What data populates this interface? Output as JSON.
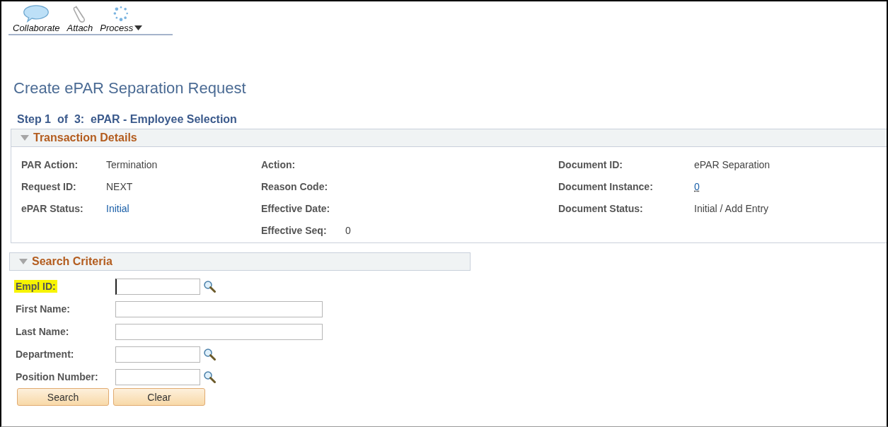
{
  "toolbar": [
    {
      "label": "Collaborate",
      "kind": "bubble",
      "has_menu": false
    },
    {
      "label": "Attach",
      "kind": "clip",
      "has_menu": false
    },
    {
      "label": "Process",
      "kind": "spinner",
      "has_menu": true
    }
  ],
  "title": "Create ePAR Separation Request",
  "step": "Step 1  of  3:  ePAR - Employee Selection",
  "transaction": {
    "title": "Transaction Details",
    "expanded": true,
    "columns": [
      [
        {
          "label": "PAR Action:",
          "value": "Termination",
          "link": false
        },
        {
          "label": "Request ID:",
          "value": "NEXT",
          "link": false
        },
        {
          "label": "ePAR Status:",
          "value": "Initial",
          "link": true
        }
      ],
      [
        {
          "label": "Action:"
        },
        {
          "label": "Reason Code:"
        },
        {
          "label": "Effective Date:"
        },
        {
          "label": "Effective Seq:",
          "value": "0",
          "link": false
        }
      ],
      [
        {
          "label": "Document ID:",
          "value": "ePAR Separation",
          "link": false
        },
        {
          "label": "Document Instance:",
          "value": "0",
          "link": true
        },
        {
          "label": "Document Status:",
          "value": "Initial / Add Entry",
          "link": false
        }
      ]
    ]
  },
  "search": {
    "title": "Search Criteria",
    "expanded": true,
    "fields": [
      {
        "label": "Empl ID:",
        "kind": "short",
        "lookup": true,
        "highlighted": true,
        "focused": true
      },
      {
        "label": "First Name:",
        "kind": "long",
        "lookup": false,
        "highlighted": false,
        "focused": false
      },
      {
        "label": "Last Name:",
        "kind": "long",
        "lookup": false,
        "highlighted": false,
        "focused": false
      },
      {
        "label": "Department:",
        "kind": "short",
        "lookup": true,
        "highlighted": false,
        "focused": false
      },
      {
        "label": "Position Number:",
        "kind": "short",
        "lookup": true,
        "highlighted": false,
        "focused": false
      }
    ],
    "buttons": [
      "Search",
      "Clear"
    ]
  }
}
